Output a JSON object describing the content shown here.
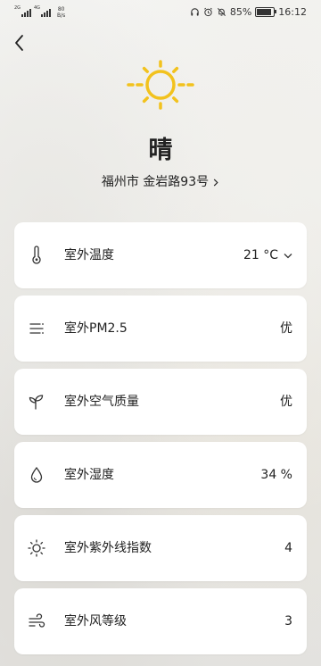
{
  "status_bar": {
    "signal1_tag": "2G",
    "signal2_tag": "4G",
    "net_speed_value": "80",
    "net_speed_unit": "B/s",
    "battery_percent": "85%",
    "battery_level": 0.85,
    "time": "16:12"
  },
  "weather": {
    "condition": "晴",
    "icon": "sun-icon",
    "icon_color": "#F2C21D"
  },
  "location": {
    "text": "福州市 金岩路93号"
  },
  "items": [
    {
      "label": "室外温度",
      "value": "21 °C",
      "icon": "thermometer-icon",
      "has_dropdown": true
    },
    {
      "label": "室外PM2.5",
      "value": "优",
      "icon": "pm25-icon"
    },
    {
      "label": "室外空气质量",
      "value": "优",
      "icon": "leaf-icon"
    },
    {
      "label": "室外湿度",
      "value": "34 %",
      "icon": "droplet-icon"
    },
    {
      "label": "室外紫外线指数",
      "value": "4",
      "icon": "sun-outline-icon"
    },
    {
      "label": "室外风等级",
      "value": "3",
      "icon": "wind-icon"
    }
  ]
}
